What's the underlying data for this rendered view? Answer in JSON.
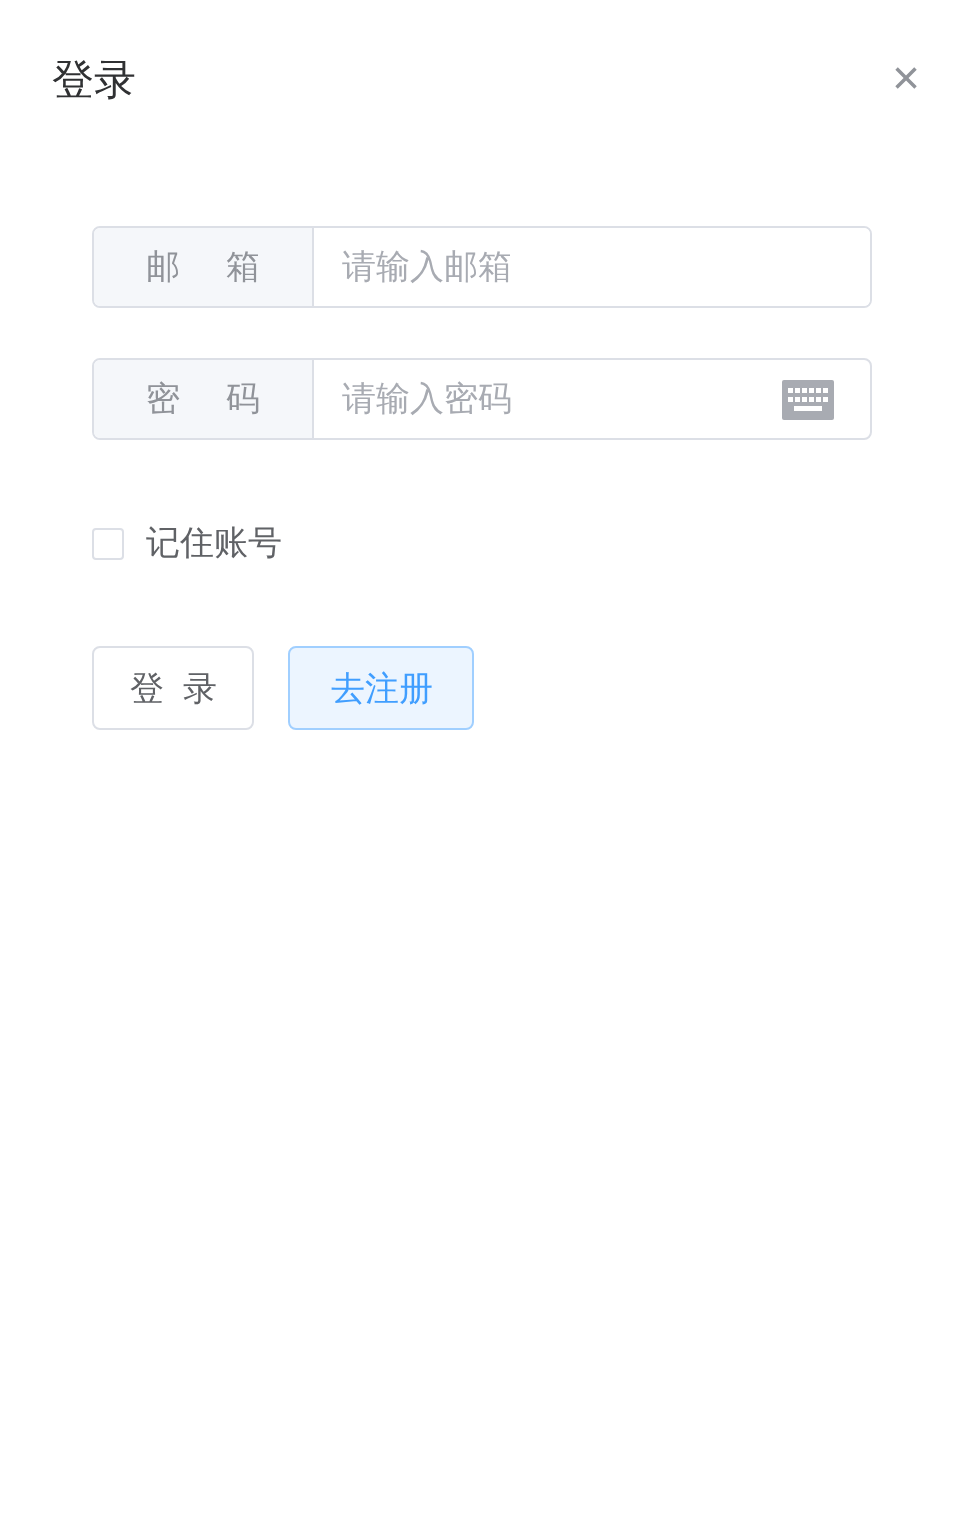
{
  "dialog": {
    "title": "登录",
    "close": "×"
  },
  "fields": [
    {
      "label": "邮 箱",
      "placeholder": "请输入邮箱",
      "kind": "text"
    },
    {
      "label": "密 码",
      "placeholder": "请输入密码",
      "kind": "password"
    }
  ],
  "remember": {
    "label": "记住账号",
    "checked": false
  },
  "buttons": [
    {
      "label": "登 录",
      "kind": "default"
    },
    {
      "label": "去注册",
      "kind": "primary"
    }
  ]
}
